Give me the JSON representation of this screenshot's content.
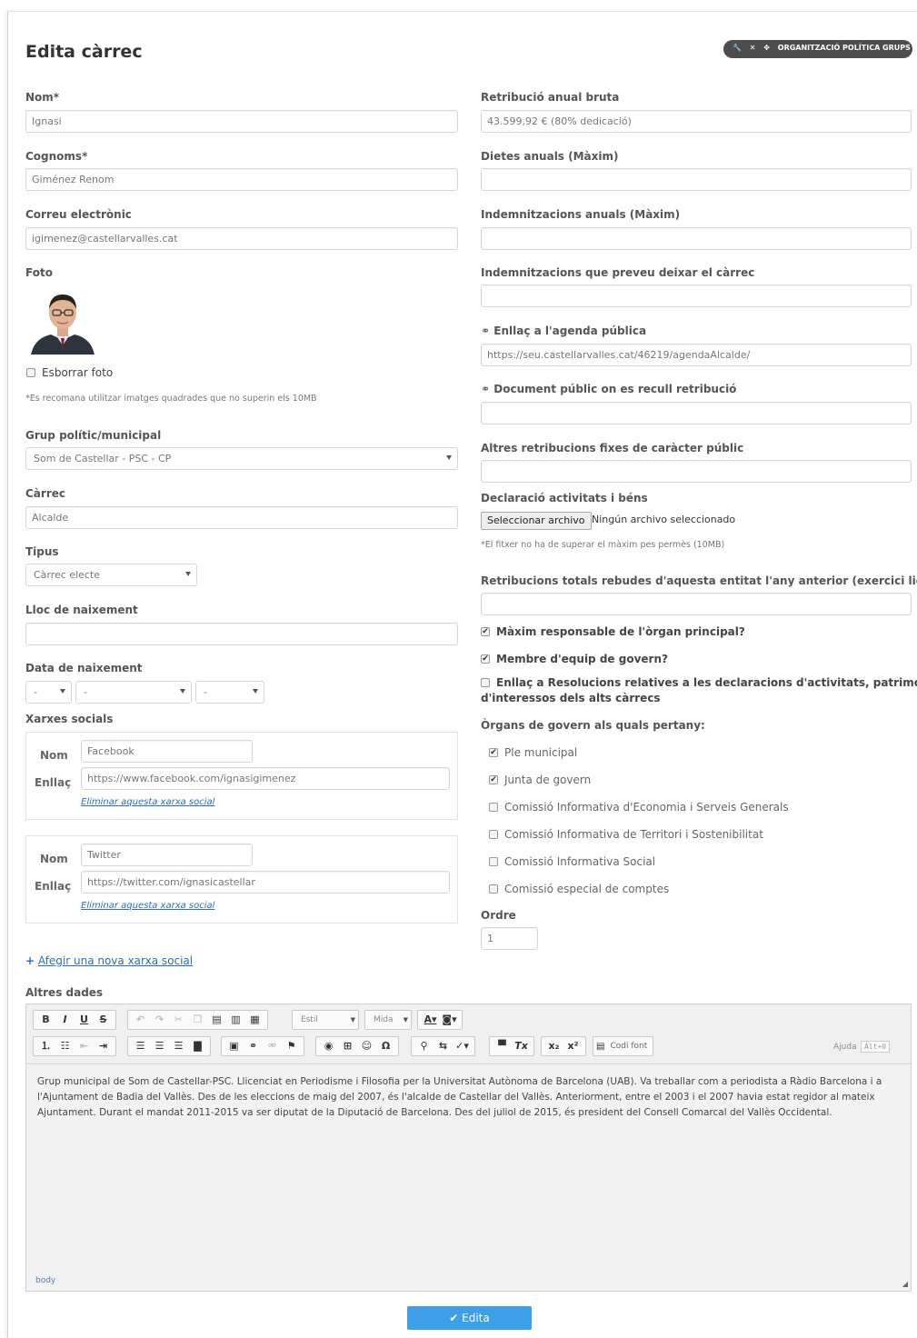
{
  "page": {
    "title": "Edita càrrec"
  },
  "top_bar": {
    "pill_text": "ORGANITZACIÓ POLÍTICA GRUPS"
  },
  "left": {
    "nom": {
      "label": "Nom*",
      "value": "Ignasi"
    },
    "cognoms": {
      "label": "Cognoms*",
      "value": "Giménez Renom"
    },
    "correu": {
      "label": "Correu electrònic",
      "value": "igimenez@castellarvalles.cat"
    },
    "foto": {
      "label": "Foto",
      "delete_label": "Esborrar foto",
      "note": "*Es recomana utilitzar imatges quadrades que no superin els 10MB"
    },
    "grup": {
      "label": "Grup polític/municipal",
      "value": "Som de Castellar - PSC - CP"
    },
    "carrec": {
      "label": "Càrrec",
      "value": "Alcalde"
    },
    "tipus": {
      "label": "Tipus",
      "value": "Càrrec electe"
    },
    "lloc": {
      "label": "Lloc de naixement",
      "value": ""
    },
    "data": {
      "label": "Data de naixement",
      "day": "-",
      "month": "-",
      "year": "-"
    },
    "xarxes": {
      "label": "Xarxes socials",
      "nom_label": "Nom",
      "enllac_label": "Enllaç",
      "remove_label": "Eliminar aquesta xarxa social",
      "items": [
        {
          "nom": "Facebook",
          "url": "https://www.facebook.com/ignasigimenez"
        },
        {
          "nom": "Twitter",
          "url": "https://twitter.com/ignasicastellar"
        }
      ],
      "add_label": "Afegir una nova xarxa social"
    }
  },
  "right": {
    "retribucio": {
      "label": "Retribució anual bruta",
      "value": "43.599,92 € (80% dedicació)"
    },
    "dietes": {
      "label": "Dietes anuals (Màxim)",
      "value": ""
    },
    "indemnitzacions": {
      "label": "Indemnitzacions anuals (Màxim)",
      "value": ""
    },
    "indemnitzacions_deixar": {
      "label": "Indemnitzacions que preveu deixar el càrrec",
      "value": ""
    },
    "agenda": {
      "label": "Enllaç a l'agenda pública",
      "value": "https://seu.castellarvalles.cat/46219/agendaAlcalde/"
    },
    "document": {
      "label": "Document públic on es recull retribució",
      "value": ""
    },
    "altres_retribucions": {
      "label": "Altres retribucions fixes de caràcter públic",
      "value": ""
    },
    "declaracio": {
      "label": "Declaració activitats i béns",
      "button": "Seleccionar archivo",
      "status": "Ningún archivo seleccionado",
      "note": "*El fitxer no ha de superar el màxim pes permès (10MB)"
    },
    "retribucions_totals": {
      "label": "Retribucions totals rebudes d'aquesta entitat l'any anterior (exercici liquidat)",
      "value": ""
    },
    "checks": {
      "maxim": "Màxim responsable de l'òrgan principal?",
      "membre": "Membre d'equip de govern?",
      "enllac_line1": "Enllaç a Resolucions relatives a les declaracions d'activitats, patrimonials i",
      "enllac_line2": "d'interessos dels alts càrrecs"
    },
    "organs": {
      "label": "Òrgans de govern als quals pertany:",
      "items": [
        {
          "label": "Ple municipal",
          "checked": true
        },
        {
          "label": "Junta de govern",
          "checked": true
        },
        {
          "label": "Comissió Informativa d'Economia i Serveis Generals",
          "checked": false
        },
        {
          "label": "Comissió Informativa de Territori i Sostenibilitat",
          "checked": false
        },
        {
          "label": "Comissió Informativa Social",
          "checked": false
        },
        {
          "label": "Comissió especial de comptes",
          "checked": false
        }
      ]
    },
    "ordre": {
      "label": "Ordre",
      "value": "1"
    }
  },
  "altres_dades": {
    "label": "Altres dades",
    "toolbar": {
      "estil": "Estil",
      "mida": "Mida",
      "codi_font": "Codi font",
      "ajuda": "Ajuda",
      "ajuda_key": "Alt+0"
    },
    "body": "Grup municipal de Som de Castellar-PSC. Llicenciat en Periodisme i Filosofia per la Universitat Autònoma de Barcelona (UAB). Va treballar com a periodista a Ràdio Barcelona i a l'Ajuntament de Badia del Vallès. Des de les eleccions de maig del 2007, és l'alcalde de Castellar del Vallès. Anteriorment, entre el 2003 i el 2007 havia estat regidor al mateix Ajuntament. Durant el mandat 2011-2015 va ser diputat de la Diputació de Barcelona. Des del juliol de 2015, és president del Consell Comarcal del Vallès Occidental.",
    "status": "body"
  },
  "submit": {
    "label": "Edita"
  }
}
